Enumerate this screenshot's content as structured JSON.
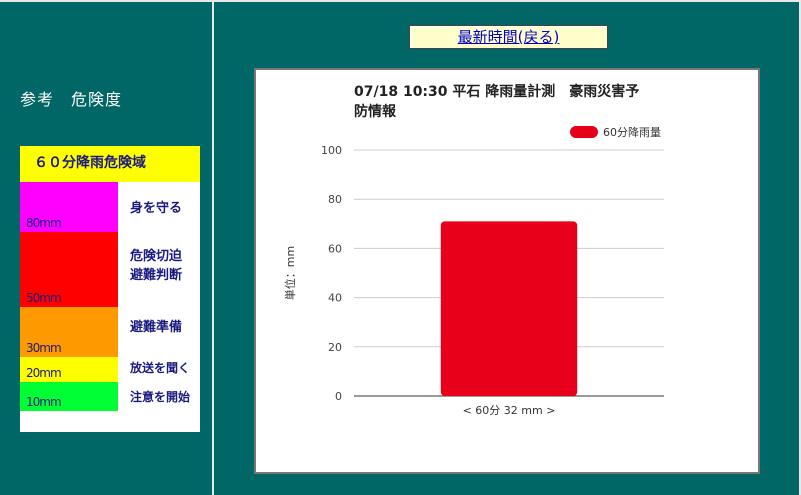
{
  "navigation": {
    "back_label": "最新時間(戻る)"
  },
  "legend_panel": {
    "title": "参考　危険度",
    "header": "６０分降雨危険域",
    "levels": [
      {
        "threshold": "80mm",
        "label": "身を守る",
        "color": "#ff00ff"
      },
      {
        "threshold": "50mm",
        "label": "危険切迫\n避難判断",
        "color": "#ff0000"
      },
      {
        "threshold": "30mm",
        "label": "避難準備",
        "color": "#ff9900"
      },
      {
        "threshold": "20mm",
        "label": "放送を聞く",
        "color": "#ffff00"
      },
      {
        "threshold": "10mm",
        "label": "注意を開始",
        "color": "#00ff33"
      }
    ]
  },
  "chart_data": {
    "type": "bar",
    "title": "07/18 10:30 平石 降雨量計測　豪雨災害予防情報",
    "title_lines": [
      "07/18 10:30 平石 降雨量計測　豪雨災害予",
      "防情報"
    ],
    "categories": [
      "< 60分 32 mm >"
    ],
    "series": [
      {
        "name": "60分降雨量",
        "values": [
          71
        ],
        "color": "#e8001a"
      }
    ],
    "ylabel": "単位：mm",
    "xlabel": "",
    "ylim": [
      0,
      100
    ],
    "yticks": [
      0,
      20,
      40,
      60,
      80,
      100
    ],
    "grid": true,
    "legend_position": "top-right"
  }
}
